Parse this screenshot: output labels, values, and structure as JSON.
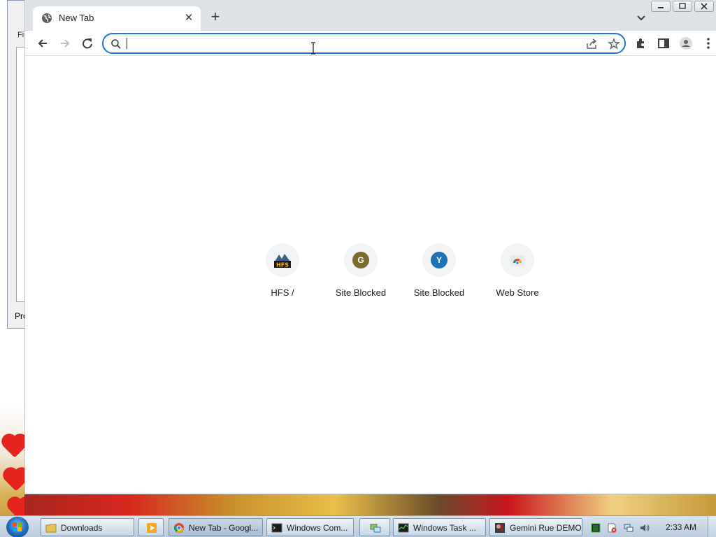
{
  "browser": {
    "tab": {
      "title": "New Tab",
      "favicon": "globe-icon",
      "close_glyph": "✕"
    },
    "new_tab_glyph": "+",
    "omnibox": {
      "value": "",
      "placeholder": ""
    },
    "colors": {
      "focus_ring": "#1a73e8",
      "tab_strip": "#dfe3e7"
    }
  },
  "shortcuts": [
    {
      "label": "HFS /",
      "icon": "hfs-icon",
      "letter": "",
      "color": ""
    },
    {
      "label": "Site Blocked",
      "icon": "letter-tile",
      "letter": "G",
      "color": "#7a6a2e"
    },
    {
      "label": "Site Blocked",
      "icon": "letter-tile",
      "letter": "Y",
      "color": "#1f73b7"
    },
    {
      "label": "Web Store",
      "icon": "webstore-icon",
      "letter": "",
      "color": ""
    }
  ],
  "background_window": {
    "menu_fragment": "Fi",
    "status_fragment": "Pro"
  },
  "taskbar": {
    "buttons": [
      {
        "label": "Downloads",
        "icon": "folder-icon"
      },
      {
        "label": "",
        "icon": "media-player-icon"
      },
      {
        "label": "New Tab - Googl...",
        "icon": "chrome-icon"
      },
      {
        "label": "Windows Com...",
        "icon": "cmd-icon"
      },
      {
        "label": "",
        "icon": "network-share-icon"
      },
      {
        "label": "Windows Task ...",
        "icon": "task-manager-icon"
      },
      {
        "label": "Gemini Rue DEMO",
        "icon": "game-icon"
      }
    ],
    "clock": "2:33 AM"
  }
}
